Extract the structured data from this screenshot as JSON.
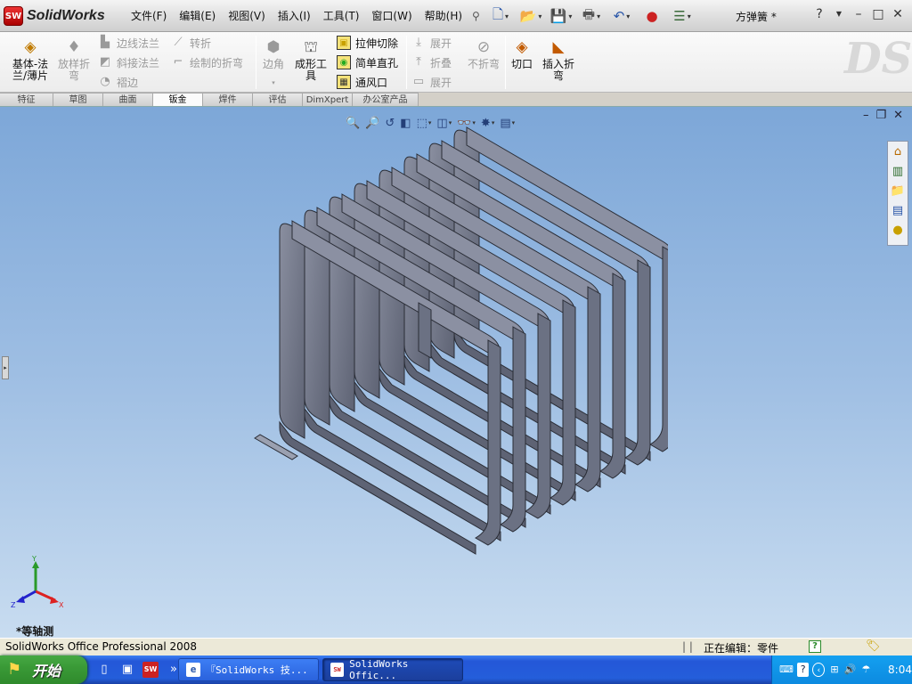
{
  "app": {
    "brand": "SolidWorks",
    "badge": "SW",
    "document_title": "方弹簧 *"
  },
  "menus": [
    "文件(F)",
    "编辑(E)",
    "视图(V)",
    "插入(I)",
    "工具(T)",
    "窗口(W)",
    "帮助(H)"
  ],
  "quick_toolbar": [
    {
      "icon": "new-document-icon",
      "glyph": "🗋"
    },
    {
      "icon": "open-folder-icon",
      "glyph": "📂"
    },
    {
      "icon": "save-icon",
      "glyph": "💾"
    },
    {
      "icon": "print-icon",
      "glyph": "🖶"
    },
    {
      "icon": "undo-icon",
      "glyph": "↶"
    },
    {
      "icon": "rebuild-icon",
      "glyph": "🚦"
    },
    {
      "icon": "options-icon",
      "glyph": "☰"
    }
  ],
  "window_controls": {
    "help": "?",
    "minimize": "–",
    "restore": "□",
    "close": "✕"
  },
  "command_manager": {
    "base_flange": "基体-法\n兰/薄片",
    "lofted_bend": "放样折\n弯",
    "edge_flange": "边线法兰",
    "miter_flange": "斜接法兰",
    "hem": "褶边",
    "jog": "转折",
    "sketched_bend": "绘制的折弯",
    "corners": "边角",
    "forming_tool": "成形工\n具",
    "extruded_cut": "拉伸切除",
    "simple_hole": "简单直孔",
    "vent": "通风口",
    "unfold": "展开",
    "fold": "折叠",
    "flatten": "展开",
    "no_bends": "不折弯",
    "rip": "切口",
    "insert_bends": "插入折\n弯"
  },
  "tabs": [
    "特征",
    "草图",
    "曲面",
    "钣金",
    "焊件",
    "评估",
    "DimXpert",
    "办公室产品"
  ],
  "active_tab": "钣金",
  "viewport": {
    "view_label": "*等轴测",
    "triad": {
      "x": "X",
      "y": "Y",
      "z": "Z"
    }
  },
  "status": {
    "product": "SolidWorks Office Professional 2008",
    "separator": "| |",
    "editing": "正在编辑：零件",
    "help": "?"
  },
  "taskbar": {
    "start": "开始",
    "tasks": [
      {
        "label": "『SolidWorks 技...",
        "icon": "ie-icon"
      },
      {
        "label": "SolidWorks Offic...",
        "icon": "solidworks-icon"
      }
    ],
    "clock": "8:04"
  },
  "colors": {
    "viewport_top": "#7da7d8",
    "viewport_bottom": "#c8dcf0",
    "model": "#6b7183",
    "taskbar": "#245edb",
    "start_button": "#3a9a37"
  }
}
